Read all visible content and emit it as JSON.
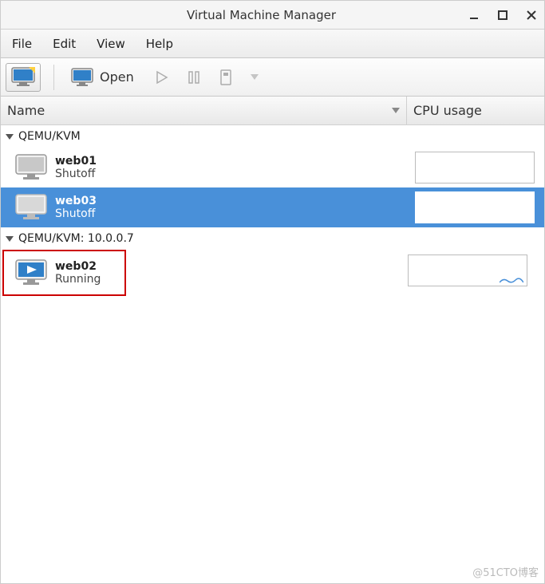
{
  "window": {
    "title": "Virtual Machine Manager"
  },
  "menu": {
    "file": "File",
    "edit": "Edit",
    "view": "View",
    "help": "Help"
  },
  "toolbar": {
    "open": "Open"
  },
  "columns": {
    "name": "Name",
    "cpu": "CPU usage"
  },
  "groups": [
    {
      "label": "QEMU/KVM",
      "vms": [
        {
          "name": "web01",
          "status": "Shutoff",
          "state": "off",
          "selected": false,
          "highlighted": false,
          "activity": false
        },
        {
          "name": "web03",
          "status": "Shutoff",
          "state": "off",
          "selected": true,
          "highlighted": false,
          "activity": false
        }
      ]
    },
    {
      "label": "QEMU/KVM: 10.0.0.7",
      "vms": [
        {
          "name": "web02",
          "status": "Running",
          "state": "running",
          "selected": false,
          "highlighted": true,
          "activity": true
        }
      ]
    }
  ],
  "watermark": "@51CTO博客"
}
